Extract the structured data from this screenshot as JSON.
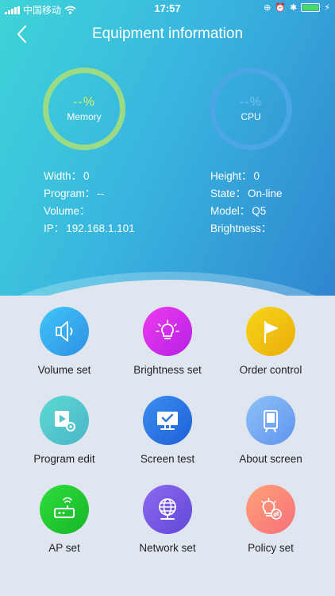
{
  "status_bar": {
    "carrier": "中国移动",
    "time": "17:57"
  },
  "nav": {
    "title": "Equipment information"
  },
  "gauges": {
    "memory": {
      "value": "--%",
      "label": "Memory"
    },
    "cpu": {
      "value": "--%",
      "label": "CPU"
    }
  },
  "info": {
    "left": [
      {
        "key": "Width：",
        "value": "0"
      },
      {
        "key": "Program：",
        "value": "--"
      },
      {
        "key": "Volume：",
        "value": ""
      },
      {
        "key": "IP：",
        "value": "192.168.1.101"
      }
    ],
    "right": [
      {
        "key": "Height：",
        "value": "0"
      },
      {
        "key": "State：",
        "value": "On-line"
      },
      {
        "key": "Model：",
        "value": "Q5"
      },
      {
        "key": "Brightness：",
        "value": ""
      }
    ]
  },
  "menu": [
    {
      "label": "Volume set",
      "icon": "speaker-icon"
    },
    {
      "label": "Brightness set",
      "icon": "light-bulb-icon"
    },
    {
      "label": "Order control",
      "icon": "flag-icon"
    },
    {
      "label": "Program edit",
      "icon": "video-gear-icon"
    },
    {
      "label": "Screen test",
      "icon": "monitor-check-icon"
    },
    {
      "label": "About screen",
      "icon": "device-screen-icon"
    },
    {
      "label": "AP set",
      "icon": "router-icon"
    },
    {
      "label": "Network set",
      "icon": "globe-network-icon"
    },
    {
      "label": "Policy set",
      "icon": "bulb-cycle-icon"
    }
  ]
}
